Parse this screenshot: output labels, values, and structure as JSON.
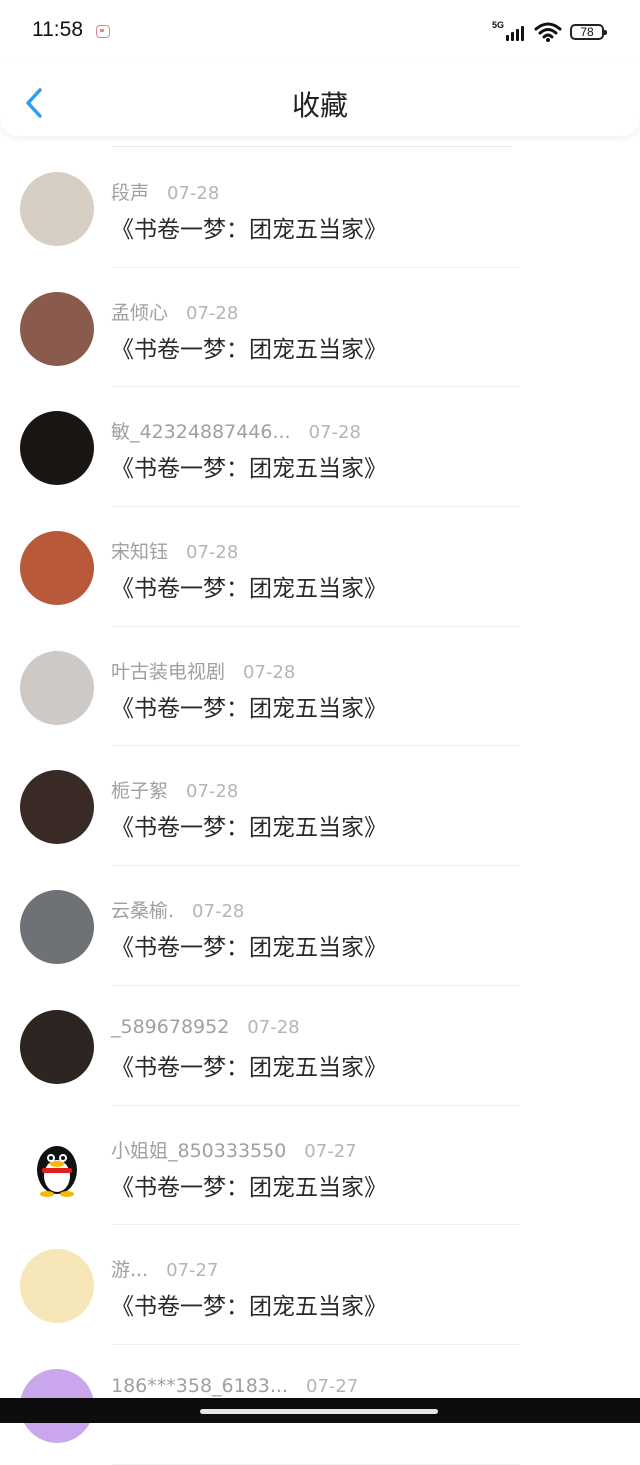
{
  "status": {
    "time": "11:58",
    "network": "5G",
    "battery": "78"
  },
  "header": {
    "title": "收藏"
  },
  "items": [
    {
      "name": "段声",
      "date": "07-28",
      "book": "《书卷一梦：团宠五当家》",
      "avatar_color": "#d8cfc4"
    },
    {
      "name": "孟倾心",
      "date": "07-28",
      "book": "《书卷一梦：团宠五当家》",
      "avatar_color": "#8a5a4c"
    },
    {
      "name": "敏_42324887446...",
      "date": "07-28",
      "book": "《书卷一梦：团宠五当家》",
      "avatar_color": "#1a1614"
    },
    {
      "name": "宋知钰",
      "date": "07-28",
      "book": "《书卷一梦：团宠五当家》",
      "avatar_color": "#b85a3a"
    },
    {
      "name": "叶古装电视剧",
      "date": "07-28",
      "book": "《书卷一梦：团宠五当家》",
      "avatar_color": "#cfc9c6"
    },
    {
      "name": "栀子絮",
      "date": "07-28",
      "book": "《书卷一梦：团宠五当家》",
      "avatar_color": "#3a2a26"
    },
    {
      "name": "云桑榆.",
      "date": "07-28",
      "book": "《书卷一梦：团宠五当家》",
      "avatar_color": "#6e7176"
    },
    {
      "name": "_589678952",
      "date": "07-28",
      "book": "《书卷一梦：团宠五当家》",
      "avatar_color": "#2d2522"
    },
    {
      "name": "小姐姐_850333550",
      "date": "07-27",
      "book": "《书卷一梦：团宠五当家》",
      "avatar_color": "#ffffff",
      "avatar_icon": "penguin-icon"
    },
    {
      "name": "游...",
      "date": "07-27",
      "book": "《书卷一梦：团宠五当家》",
      "avatar_color": "#f6e7b8"
    },
    {
      "name": "186***358_6183...",
      "date": "07-27",
      "book": "",
      "avatar_color": "#caa6ec"
    }
  ]
}
